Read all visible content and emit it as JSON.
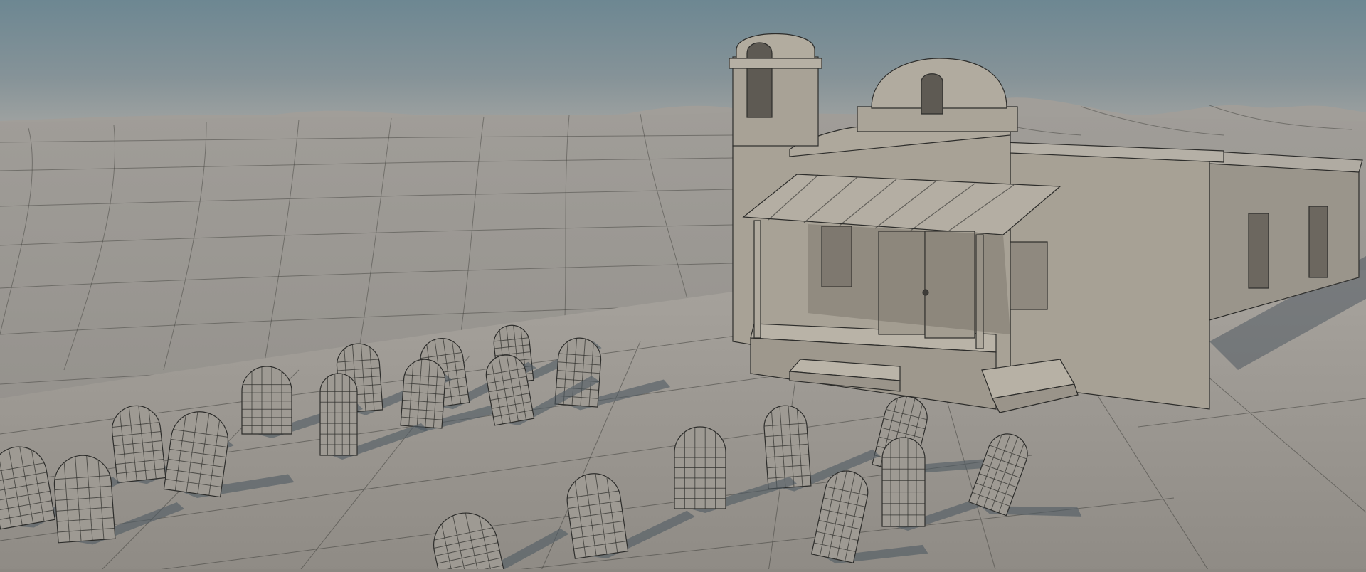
{
  "scene": {
    "subject": "wireframe-render",
    "colors": {
      "sky_top": "#6f8893",
      "sky_horizon": "#a3a6a4",
      "ground": "#9b9892",
      "hills": "#a19d98",
      "building": "#a6a094",
      "building_shadow": "#7d786f",
      "stone": "#9e9a93",
      "wire": "#2d2d2b",
      "shadow": "#4f5a63"
    },
    "tombstone_count": 20
  }
}
